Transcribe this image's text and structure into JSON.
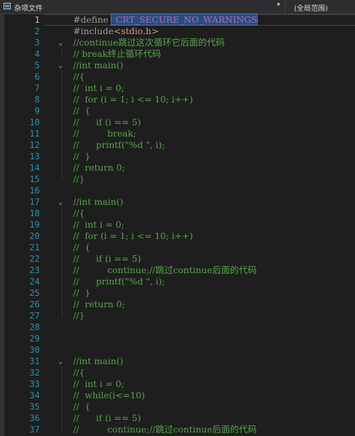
{
  "toolbar": {
    "file_label": "杂项文件",
    "scope_label": "(全局范围)"
  },
  "lines": [
    {
      "n": "1",
      "segs": [
        {
          "c": "k-dir",
          "t": "#define "
        },
        {
          "c": "k-macro",
          "t": "_CRT_SECURE_NO_WARNINGS"
        }
      ]
    },
    {
      "n": "2",
      "segs": [
        {
          "c": "k-dir",
          "t": "#include"
        },
        {
          "c": "k-str",
          "t": "<stdio.h>"
        }
      ]
    },
    {
      "n": "3",
      "fold": true,
      "segs": [
        {
          "c": "k-com",
          "t": "//continue跳过这次循环它后面的代码"
        }
      ]
    },
    {
      "n": "4",
      "segs": [
        {
          "c": "k-com",
          "t": "// break终止循环代码"
        }
      ]
    },
    {
      "n": "5",
      "fold": true,
      "segs": [
        {
          "c": "k-com",
          "t": "//int main()"
        }
      ]
    },
    {
      "n": "6",
      "segs": [
        {
          "c": "k-com",
          "t": "//{"
        }
      ]
    },
    {
      "n": "7",
      "segs": [
        {
          "c": "k-com",
          "t": "//  int i = 0;"
        }
      ]
    },
    {
      "n": "8",
      "segs": [
        {
          "c": "k-com",
          "t": "//  for (i = 1; i <= 10; i++)"
        }
      ]
    },
    {
      "n": "9",
      "segs": [
        {
          "c": "k-com",
          "t": "//  {"
        }
      ]
    },
    {
      "n": "10",
      "segs": [
        {
          "c": "k-com",
          "t": "//      if (i == 5)"
        }
      ]
    },
    {
      "n": "11",
      "segs": [
        {
          "c": "k-com",
          "t": "//          break;"
        }
      ]
    },
    {
      "n": "12",
      "segs": [
        {
          "c": "k-com",
          "t": "//      printf(\"%d \", i);"
        }
      ]
    },
    {
      "n": "13",
      "segs": [
        {
          "c": "k-com",
          "t": "//  }"
        }
      ]
    },
    {
      "n": "14",
      "segs": [
        {
          "c": "k-com",
          "t": "//  return 0;"
        }
      ]
    },
    {
      "n": "15",
      "segs": [
        {
          "c": "k-com",
          "t": "//}"
        }
      ]
    },
    {
      "n": "16",
      "segs": []
    },
    {
      "n": "17",
      "fold": true,
      "segs": [
        {
          "c": "k-com",
          "t": "//int main()"
        }
      ]
    },
    {
      "n": "18",
      "segs": [
        {
          "c": "k-com",
          "t": "//{"
        }
      ]
    },
    {
      "n": "19",
      "segs": [
        {
          "c": "k-com",
          "t": "//  int i = 0;"
        }
      ]
    },
    {
      "n": "20",
      "segs": [
        {
          "c": "k-com",
          "t": "//  for (i = 1; i <= 10; i++)"
        }
      ]
    },
    {
      "n": "21",
      "segs": [
        {
          "c": "k-com",
          "t": "//  {"
        }
      ]
    },
    {
      "n": "22",
      "segs": [
        {
          "c": "k-com",
          "t": "//      if (i == 5)"
        }
      ]
    },
    {
      "n": "23",
      "segs": [
        {
          "c": "k-com",
          "t": "//          continue;//跳过continue后面的代码"
        }
      ]
    },
    {
      "n": "24",
      "segs": [
        {
          "c": "k-com",
          "t": "//      printf(\"%d \", i);"
        }
      ]
    },
    {
      "n": "25",
      "segs": [
        {
          "c": "k-com",
          "t": "//  }"
        }
      ]
    },
    {
      "n": "26",
      "segs": [
        {
          "c": "k-com",
          "t": "//  return 0;"
        }
      ]
    },
    {
      "n": "27",
      "segs": [
        {
          "c": "k-com",
          "t": "//}"
        }
      ]
    },
    {
      "n": "28",
      "segs": []
    },
    {
      "n": "29",
      "segs": []
    },
    {
      "n": "30",
      "segs": []
    },
    {
      "n": "31",
      "fold": true,
      "segs": [
        {
          "c": "k-com",
          "t": "//int main()"
        }
      ]
    },
    {
      "n": "32",
      "segs": [
        {
          "c": "k-com",
          "t": "//{"
        }
      ]
    },
    {
      "n": "33",
      "segs": [
        {
          "c": "k-com",
          "t": "//  int i = 0;"
        }
      ]
    },
    {
      "n": "34",
      "segs": [
        {
          "c": "k-com",
          "t": "//  while(i<=10)"
        }
      ]
    },
    {
      "n": "35",
      "segs": [
        {
          "c": "k-com",
          "t": "//  {"
        }
      ]
    },
    {
      "n": "36",
      "segs": [
        {
          "c": "k-com",
          "t": "//      if (i == 5)"
        }
      ]
    },
    {
      "n": "37",
      "segs": [
        {
          "c": "k-com",
          "t": "//          continue;//跳过continue后面的代码"
        }
      ]
    }
  ]
}
